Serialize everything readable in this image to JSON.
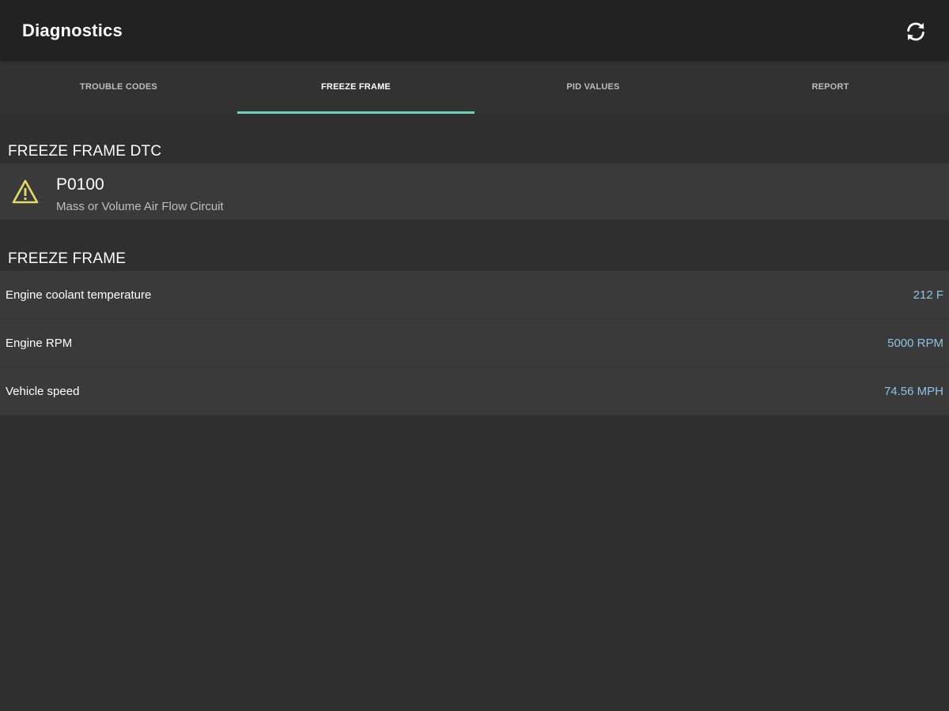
{
  "app_bar": {
    "title": "Diagnostics",
    "refresh_icon": "refresh-icon"
  },
  "tabs": [
    {
      "label": "TROUBLE CODES",
      "active": false
    },
    {
      "label": "FREEZE FRAME",
      "active": true
    },
    {
      "label": "PID VALUES",
      "active": false
    },
    {
      "label": "REPORT",
      "active": false
    }
  ],
  "dtc_section": {
    "header": "FREEZE FRAME DTC",
    "item": {
      "icon": "warning-icon",
      "code": "P0100",
      "description": "Mass or Volume Air Flow Circuit"
    }
  },
  "freeze_frame_section": {
    "header": "FREEZE FRAME",
    "rows": [
      {
        "label": "Engine coolant temperature",
        "value": "212 F"
      },
      {
        "label": "Engine RPM",
        "value": "5000 RPM"
      },
      {
        "label": "Vehicle speed",
        "value": "74.56 MPH"
      }
    ]
  },
  "colors": {
    "accent": "#6fcfb9",
    "value_text": "#8ec3e6",
    "warning": "#e3dc6a",
    "background": "#2f2f2f",
    "app_bar": "#222222"
  }
}
